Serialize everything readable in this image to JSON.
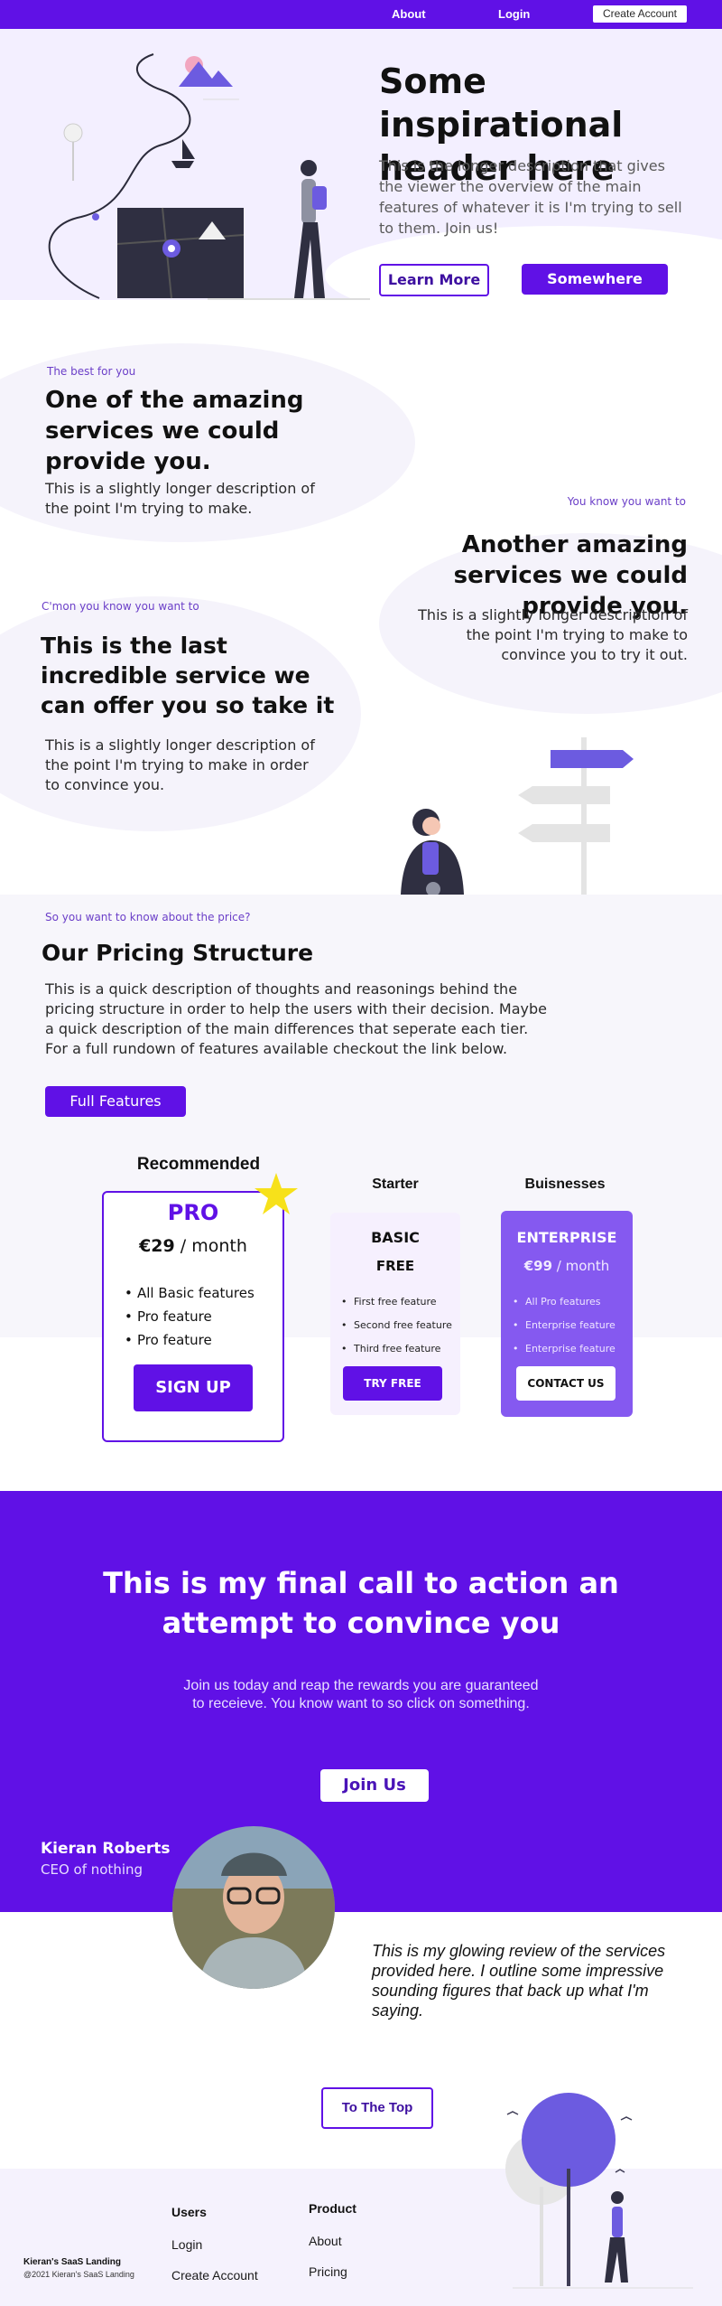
{
  "nav": {
    "about": "About",
    "login": "Login",
    "create_account": "Create Account"
  },
  "hero": {
    "title": "Some inspirational header here",
    "description": "This is the longer description that gives the viewer the overview of the main features of whatever it is I'm trying to sell to them. Join us!",
    "learn_more": "Learn More",
    "somewhere": "Somewhere"
  },
  "services": [
    {
      "eyebrow": "The best for you",
      "title": "One of the amazing services we could provide you.",
      "description": "This is a slightly longer description of the point I'm trying to make."
    },
    {
      "eyebrow": "You know you want to",
      "title": "Another amazing services we could provide you.",
      "description": "This is a slightly longer description of the point I'm trying to make to convince you to try it out."
    },
    {
      "eyebrow": "C'mon you know you want to",
      "title": "This is the last incredible service we can offer you so take it",
      "description": "This is a slightly longer description of the point I'm trying to make in order to convince you."
    }
  ],
  "pricing": {
    "eyebrow": "So you want to know about the price?",
    "title": "Our Pricing Structure",
    "description": "This is a quick description of thoughts and reasonings behind the pricing structure in order to help the users with their decision. Maybe a quick description of the main differences that seperate each tier. For a full rundown of features available checkout the link below.",
    "full_features": "Full Features",
    "recommended_label": "Recommended",
    "starter_label": "Starter",
    "business_label": "Buisnesses",
    "pro": {
      "name": "PRO",
      "price": "€29",
      "period": " / month",
      "features": [
        "All Basic features",
        "Pro feature",
        "Pro feature"
      ],
      "button": "SIGN UP"
    },
    "basic": {
      "name": "BASIC",
      "price": "FREE",
      "features": [
        "First free feature",
        "Second free feature",
        "Third free feature"
      ],
      "button": "TRY FREE"
    },
    "enterprise": {
      "name": "ENTERPRISE",
      "price": "€99",
      "period": " / month",
      "features": [
        "All Pro features",
        "Enterprise feature",
        "Enterprise  feature"
      ],
      "button": "CONTACT US"
    }
  },
  "cta": {
    "title": "This is my final call to action an attempt to convince you",
    "description": "Join us today and reap the rewards you are guaranteed to receieve. You know want to so click on something.",
    "join_us": "Join Us"
  },
  "testimonial": {
    "name": "Kieran Roberts",
    "role": "CEO of nothing",
    "review": "This is my glowing review of the services provided here. I outline some impressive sounding figures that back up what I'm saying."
  },
  "to_top": "To The Top",
  "footer": {
    "brand": "Kieran's SaaS Landing",
    "copyright": "@2021 Kieran's SaaS Landing",
    "users_heading": "Users",
    "users_links": [
      "Login",
      "Create Account"
    ],
    "product_heading": "Product",
    "product_links": [
      "About",
      "Pricing"
    ]
  },
  "colors": {
    "primary": "#6011e6",
    "light_purple_bg": "#f3efff",
    "star": "#f7e11a"
  }
}
